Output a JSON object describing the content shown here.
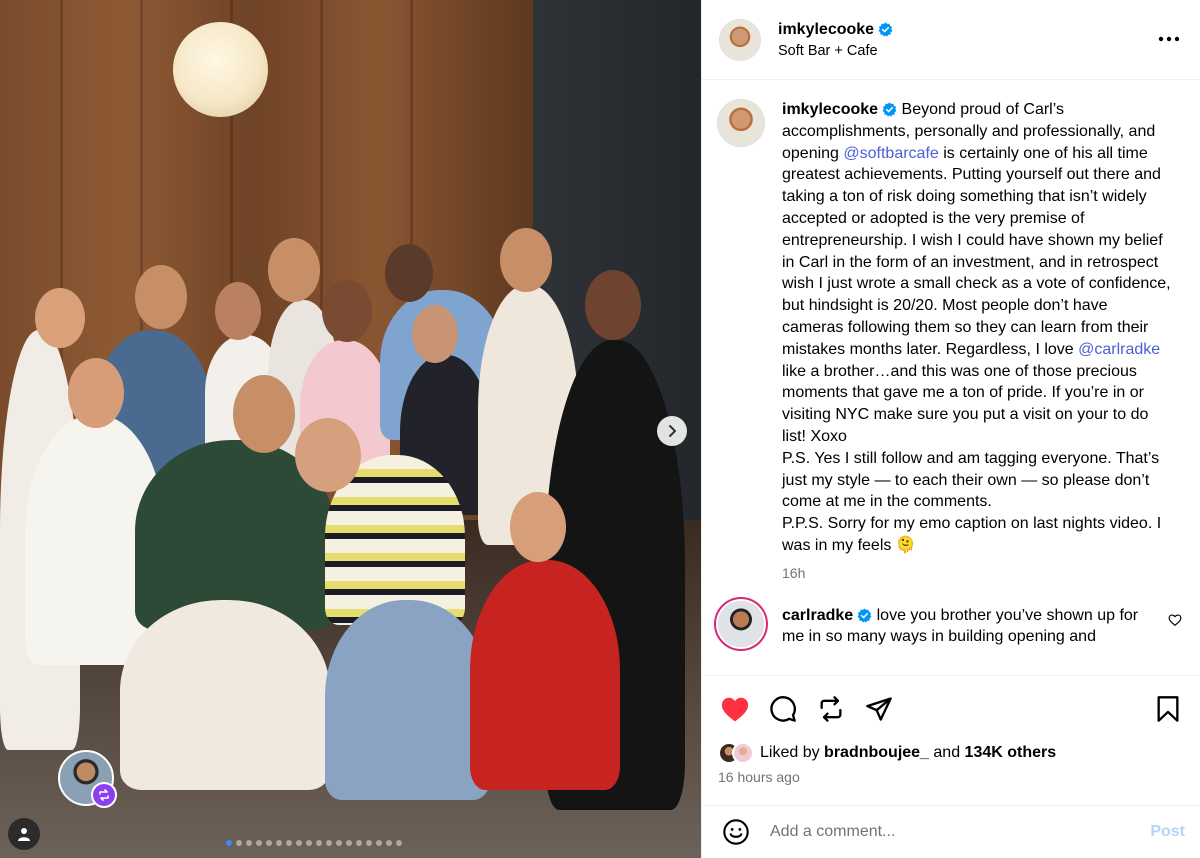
{
  "header": {
    "username": "imkylecooke",
    "location": "Soft Bar + Cafe",
    "more_icon": "more-horizontal-icon"
  },
  "caption": {
    "username": "imkylecooke",
    "text_1": "Beyond proud of Carl’s accomplishments, personally and professionally, and opening ",
    "mention_1": "@softbarcafe",
    "text_2": " is certainly one of his all time greatest achievements. Putting yourself out there and taking a ton of risk doing something that isn’t widely accepted or adopted is the very premise of entrepreneurship. I wish I could have shown my belief in Carl in the form of an investment, and in retrospect wish I just wrote a small check as a vote of confidence, but hindsight is 20/20. Most people don’t have cameras following them so they can learn from their mistakes months later. Regardless, I love ",
    "mention_2": "@carlradke",
    "text_3": " like a brother…and this was one of those precious moments that gave me a ton of pride. If you’re in or visiting NYC make sure you put a visit on your to do list! Xoxo",
    "ps": "P.S. Yes I still follow and am tagging everyone. That’s just my style — to each their own — so please don’t come at me in the comments.",
    "pps": "P.P.S. Sorry for my emo caption on last nights video. I was in my feels 🫠",
    "time": "16h"
  },
  "reply": {
    "username": "carlradke",
    "text": "love you brother you’ve shown up for me in so many ways in building opening and"
  },
  "engagement": {
    "liked_by_prefix": "Liked by ",
    "liked_by_user": "bradnboujee_",
    "liked_by_joiner": " and ",
    "likes_count": "134K others",
    "time_ago": "16 hours ago",
    "liked": true,
    "like_color": "#ff3040"
  },
  "comment_bar": {
    "placeholder": "Add a comment...",
    "post_label": "Post"
  },
  "carousel": {
    "current_index": 1,
    "total": 18
  },
  "colors": {
    "verified": "#0095f6",
    "mention": "#4c5fd7",
    "secondary_text": "#737373",
    "post_button": "#b3d4f8"
  }
}
